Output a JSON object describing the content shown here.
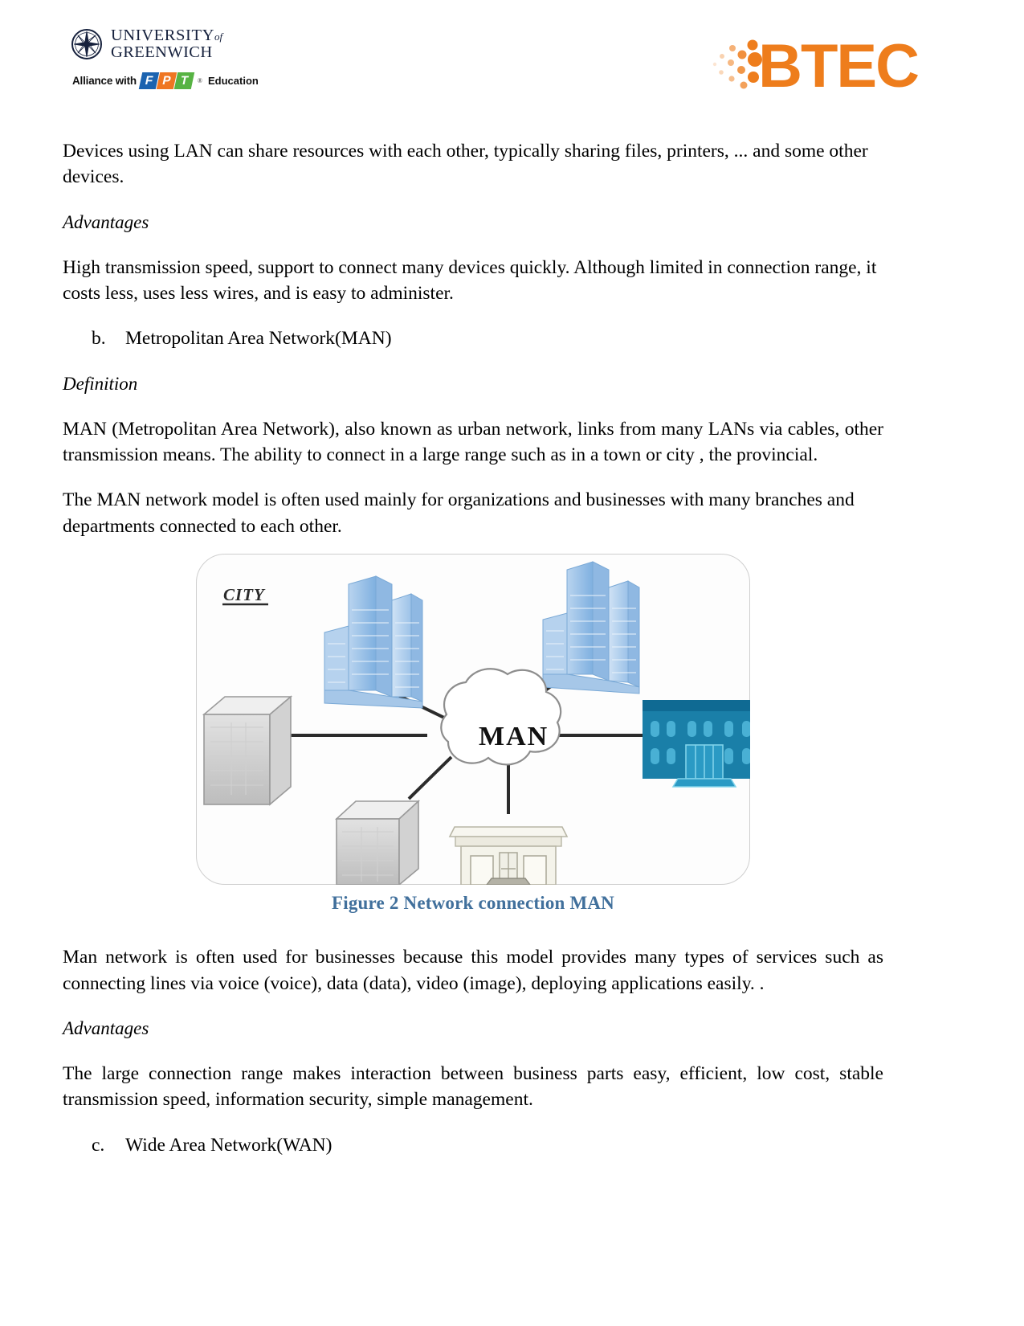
{
  "header": {
    "university": {
      "line1": "UNIVERSITY",
      "line1_suffix": "of",
      "line2": "GREENWICH",
      "seal_icon": "compass-rose-seal-icon"
    },
    "alliance": {
      "prefix": "Alliance with",
      "brand_letters": [
        "F",
        "P",
        "T"
      ],
      "registered_mark": "®",
      "suffix": "Education"
    },
    "btec": {
      "wordmark": "BTEC",
      "dots_icon": "btec-dots-icon",
      "color": "#ee7d1c"
    }
  },
  "body": {
    "p_lan_share": "Devices using LAN can share resources with each other, typically sharing files, printers, ... and some other devices.",
    "h_advantages_1": "Advantages",
    "p_lan_advantages": "High transmission speed, support to connect many devices quickly. Although limited in connection range, it costs less, uses less wires, and is easy to administer.",
    "list_b_marker": "b.",
    "list_b_text": "Metropolitan Area Network(MAN)",
    "h_definition": "Definition",
    "p_man_definition": "MAN (Metropolitan Area Network), also known as urban network, links from many LANs via cables, other transmission means. The ability to connect in a large range such as in a town or city , the provincial.",
    "p_man_model": "The MAN network model is often used mainly for organizations and businesses with many branches and departments connected to each other.",
    "p_man_business": "Man network is often used for businesses because this model provides many types of services such as connecting lines via voice (voice), data (data), video (image), deploying applications easily. .",
    "h_advantages_2": "Advantages",
    "p_man_advantages": "The large connection range makes interaction between business parts easy, efficient, low cost, stable transmission speed, information security, simple management.",
    "list_c_marker": "c.",
    "list_c_text": "Wide Area Network(WAN)"
  },
  "figure": {
    "caption": "Figure 2 Network connection MAN",
    "caption_color": "#41709c",
    "city_label": "CITY",
    "cloud_label": "MAN",
    "nodes": [
      {
        "name": "skyscraper-left",
        "type": "blue-skyscraper"
      },
      {
        "name": "skyscraper-right",
        "type": "blue-skyscraper"
      },
      {
        "name": "server-left",
        "type": "gray-server-box"
      },
      {
        "name": "server-bottom",
        "type": "gray-server-box"
      },
      {
        "name": "office-building-right",
        "type": "teal-office-building"
      },
      {
        "name": "civic-building-bottom",
        "type": "cream-civic-building"
      }
    ],
    "colors": {
      "skyscraper": "#9dc2e8",
      "server": "#c9c9c9",
      "teal_building": "#1a7fa8",
      "civic_building": "#f2f1e8",
      "link": "#2b2b2b"
    }
  }
}
